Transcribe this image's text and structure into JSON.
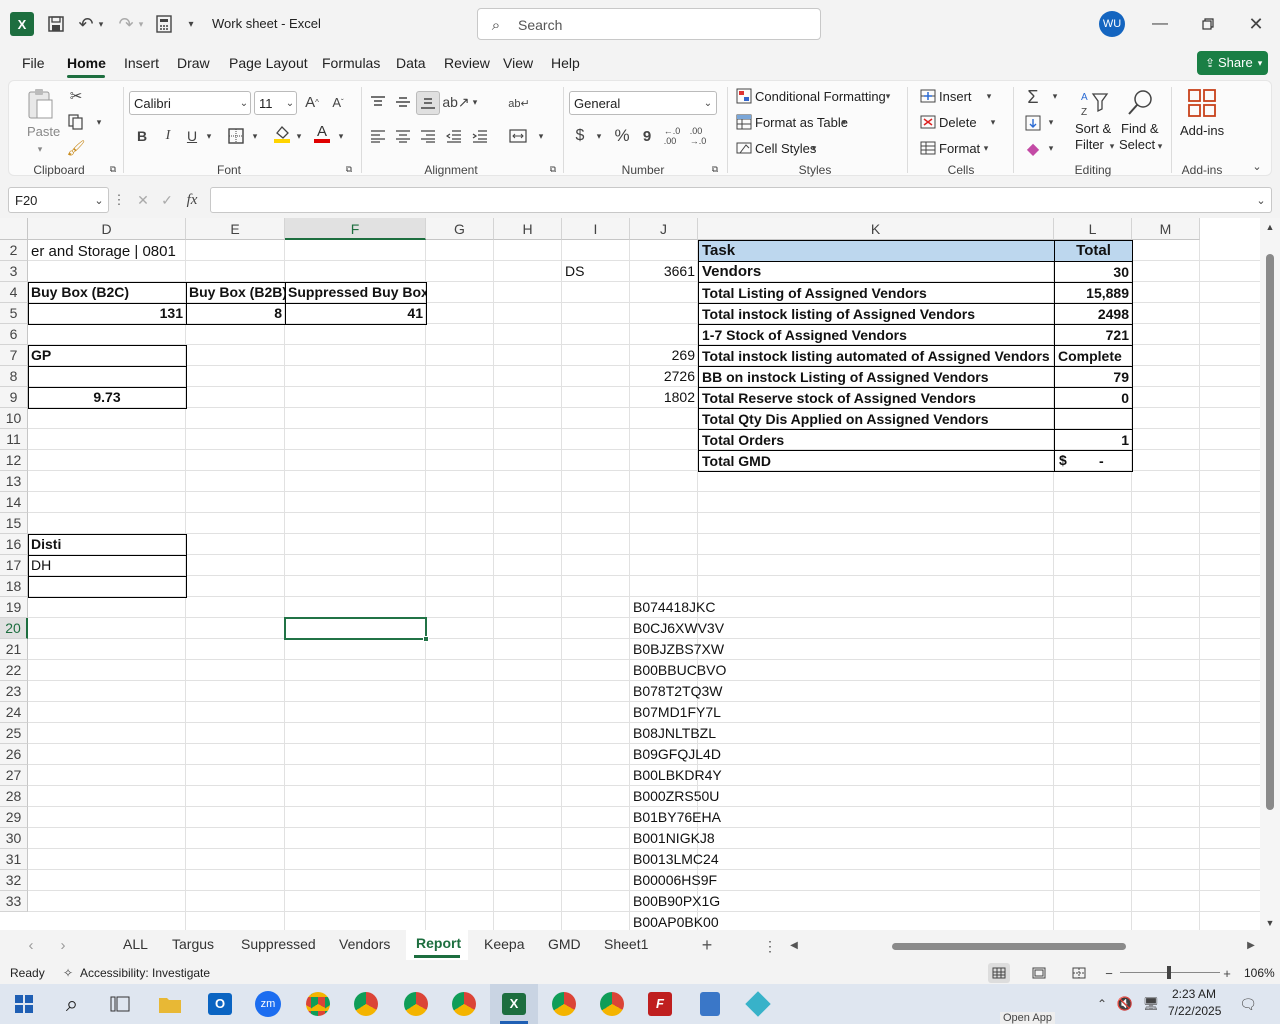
{
  "window": {
    "title": "Work sheet  -  Excel",
    "search_placeholder": "Search",
    "user_initials": "WU"
  },
  "menu": {
    "items": [
      "File",
      "Home",
      "Insert",
      "Draw",
      "Page Layout",
      "Formulas",
      "Data",
      "Review",
      "View",
      "Help"
    ],
    "active": "Home",
    "share_label": "Share"
  },
  "ribbon": {
    "clipboard": {
      "paste_label": "Paste",
      "group": "Clipboard"
    },
    "font": {
      "name": "Calibri",
      "size": "11",
      "group": "Font",
      "bold": "B",
      "italic": "I",
      "underline": "U"
    },
    "alignment": {
      "group": "Alignment"
    },
    "number": {
      "format": "General",
      "group": "Number",
      "currency": "$",
      "percent": "%",
      "comma": "9"
    },
    "styles": {
      "conditional": "Conditional Formatting",
      "format_table": "Format as Table",
      "cell_styles": "Cell Styles",
      "group": "Styles"
    },
    "cells": {
      "insert": "Insert",
      "delete": "Delete",
      "format": "Format",
      "group": "Cells"
    },
    "editing": {
      "sort_line1": "Sort &",
      "sort_line2": "Filter",
      "find_line1": "Find &",
      "find_line2": "Select",
      "group": "Editing"
    },
    "addins": {
      "label": "Add-ins",
      "group": "Add-ins"
    }
  },
  "formula_bar": {
    "name_box": "F20",
    "fx": "fx",
    "formula": ""
  },
  "columns": [
    "D",
    "E",
    "F",
    "G",
    "H",
    "I",
    "J",
    "K",
    "L",
    "M"
  ],
  "rows": [
    "2",
    "3",
    "4",
    "5",
    "6",
    "7",
    "8",
    "9",
    "10",
    "11",
    "12",
    "13",
    "14",
    "15",
    "16",
    "17",
    "18",
    "19",
    "20",
    "21",
    "22",
    "23",
    "24",
    "25",
    "26",
    "27",
    "28",
    "29",
    "30",
    "31",
    "32",
    "33"
  ],
  "cells": {
    "D2": "er and Storage | 0801",
    "D4": "Buy Box (B2C)",
    "E4": "Buy Box (B2B)",
    "F4": "Suppressed Buy Box",
    "D5": "131",
    "E5": "8",
    "F5": "41",
    "D7": "GP",
    "D9": "9.73",
    "D16": "Disti",
    "D17": "DH",
    "I3": "DS",
    "J3": "3661",
    "J7": "269",
    "J8": "2726",
    "J9": "1802"
  },
  "task_table": {
    "header_task": "Task",
    "header_total": "Total",
    "rows": [
      {
        "task": "Vendors",
        "total": "30"
      },
      {
        "task": "Total Listing of Assigned Vendors",
        "total": "15,889"
      },
      {
        "task": "Total instock listing of Assigned Vendors",
        "total": "2498"
      },
      {
        "task": "1-7 Stock of Assigned Vendors",
        "total": "721"
      },
      {
        "task": "Total instock listing automated of Assigned Vendors",
        "total": "Complete"
      },
      {
        "task": "BB on instock Listing of Assigned Vendors",
        "total": "79"
      },
      {
        "task": "Total Reserve stock of Assigned Vendors",
        "total": "0"
      },
      {
        "task": "Total Qty Dis Applied on Assigned Vendors",
        "total": ""
      },
      {
        "task": "Total Orders",
        "total": "1"
      },
      {
        "task": "Total GMD",
        "total_symbol": "$",
        "total": "-"
      }
    ],
    "header_color": "#bdd7ee"
  },
  "asin_list": [
    "B074418JKC",
    "B0CJ6XWV3V",
    "B0BJZBS7XW",
    "B00BBUCBVO",
    "B078T2TQ3W",
    "B07MD1FY7L",
    "B08JNLTBZL",
    "B09GFQJL4D",
    "B00LBKDR4Y",
    "B000ZRS50U",
    "B01BY76EHA",
    "B001NIGKJ8",
    "B0013LMC24",
    "B00006HS9F",
    "B00B90PX1G",
    "B00AP0BK00"
  ],
  "sheet_tabs": [
    "ALL",
    "Targus",
    "Suppressed",
    "Vendors",
    "Report",
    "Keepa",
    "GMD",
    "Sheet1"
  ],
  "active_tab": "Report",
  "status": {
    "ready": "Ready",
    "accessibility": "Accessibility: Investigate",
    "zoom": "106%"
  },
  "taskbar": {
    "time": "2:23 AM",
    "date": "7/22/2025",
    "open_app": "Open App"
  },
  "colors": {
    "excel_green": "#1d6e3f",
    "selection": "#217346",
    "share_btn": "#1a7f45"
  }
}
